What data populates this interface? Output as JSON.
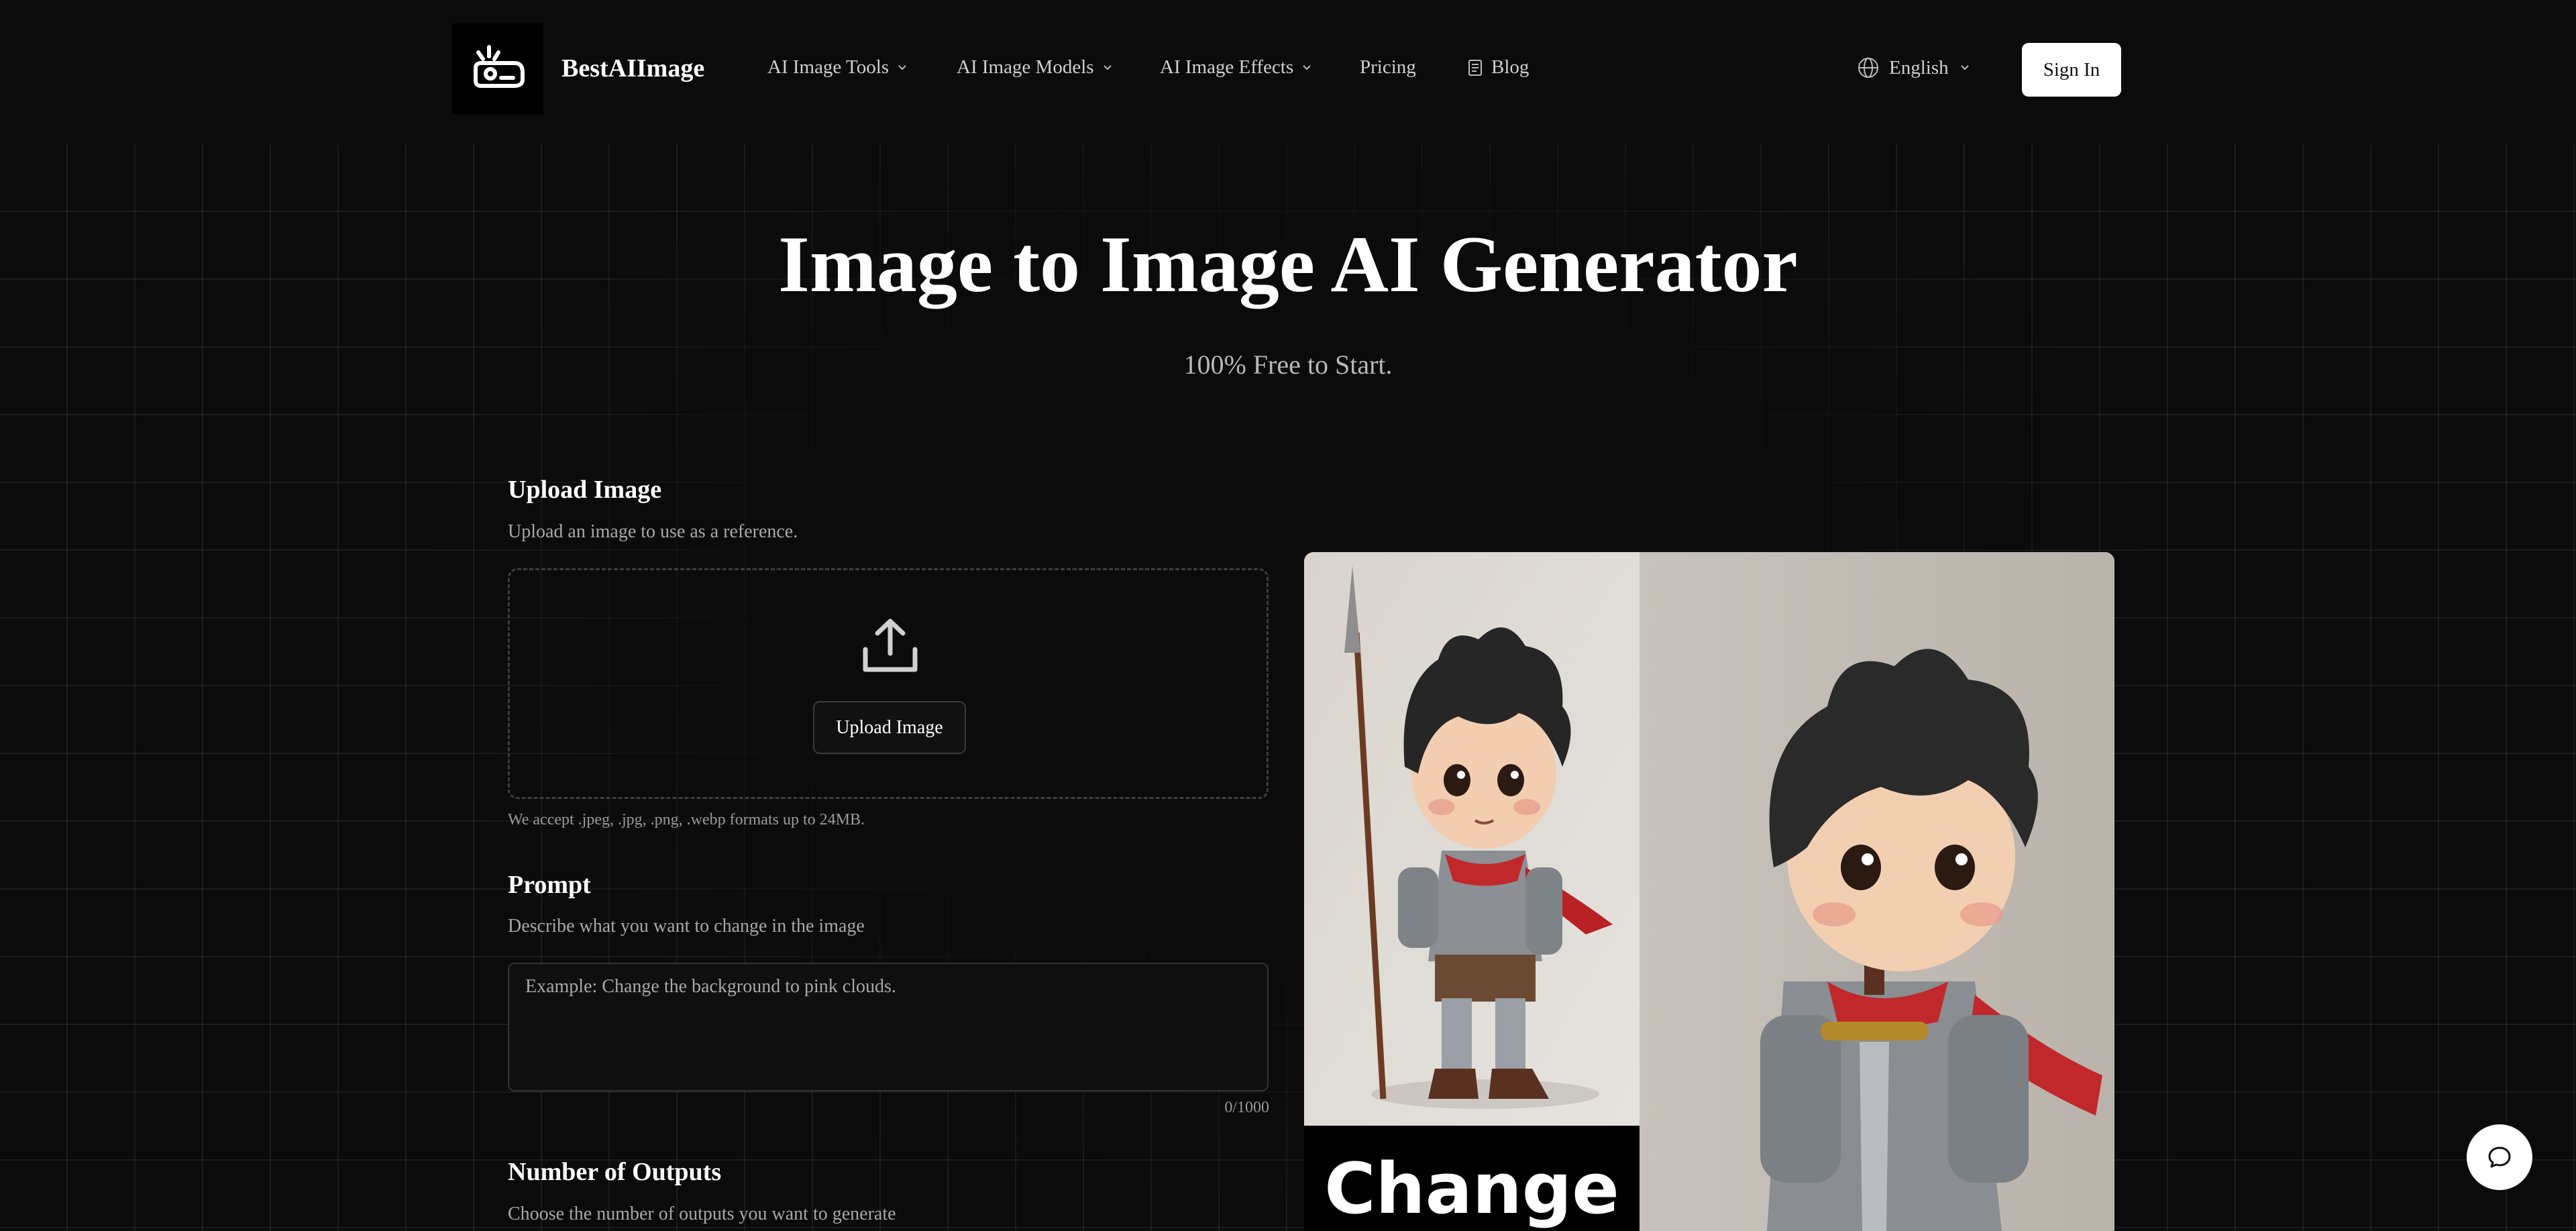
{
  "header": {
    "brand": "BestAIImage",
    "nav": [
      {
        "label": "AI Image Tools"
      },
      {
        "label": "AI Image Models"
      },
      {
        "label": "AI Image Effects"
      },
      {
        "label": "Pricing"
      },
      {
        "label": "Blog"
      }
    ],
    "language": "English",
    "sign_in": "Sign In"
  },
  "hero": {
    "title": "Image to Image AI Generator",
    "subtitle": "100% Free to Start."
  },
  "upload": {
    "title": "Upload Image",
    "description": "Upload an image to use as a reference.",
    "button": "Upload Image",
    "accept": "We accept .jpeg, .jpg, .png, .webp formats up to 24MB."
  },
  "prompt": {
    "title": "Prompt",
    "description": "Describe what you want to change in the image",
    "placeholder": "Example: Change the background to pink clouds.",
    "counter": "0/1000"
  },
  "outputs": {
    "title": "Number of Outputs",
    "description": "Choose the number of outputs you want to generate"
  },
  "preview": {
    "caption": "Change"
  },
  "icons": {
    "logo": "robot-logo-icon",
    "globe": "globe-icon",
    "blog": "document-icon",
    "upload": "upload-icon",
    "chat": "chat-bubble-icon"
  }
}
